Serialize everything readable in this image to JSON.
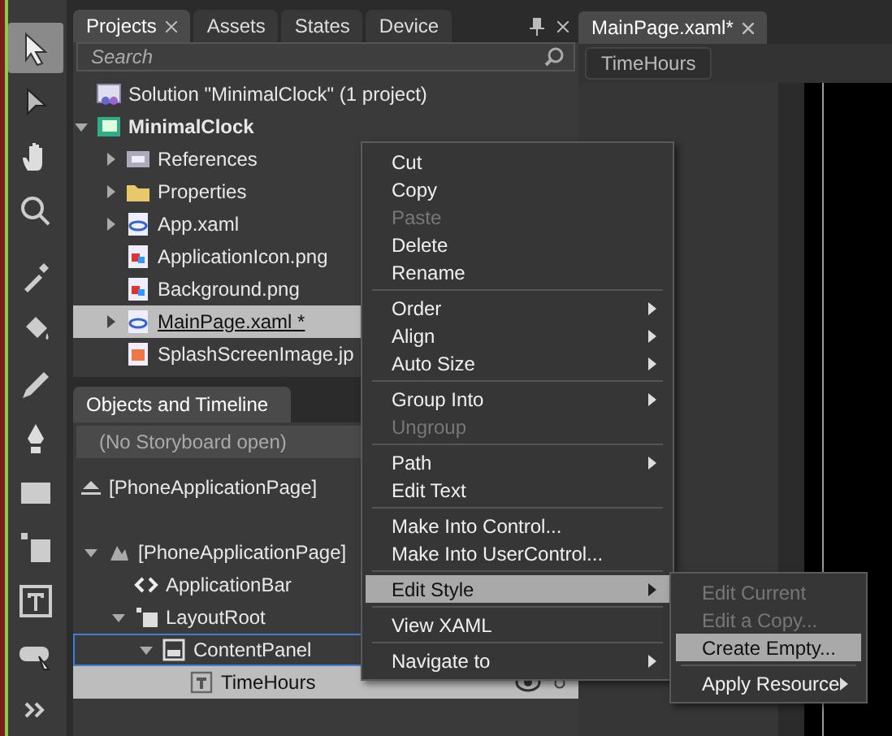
{
  "tools": [
    {
      "kind": "selection",
      "selected": true
    },
    {
      "kind": "direct-selection",
      "selected": false
    },
    {
      "kind": "pan",
      "selected": false
    },
    {
      "kind": "zoom",
      "selected": false
    },
    {
      "kind": "eyedropper",
      "selected": false
    },
    {
      "kind": "paint-bucket",
      "selected": false
    },
    {
      "kind": "pencil",
      "selected": false
    },
    {
      "kind": "pen",
      "selected": false
    },
    {
      "kind": "rectangle",
      "selected": false
    },
    {
      "kind": "grid",
      "selected": false
    },
    {
      "kind": "text",
      "selected": false
    },
    {
      "kind": "callout",
      "selected": false
    },
    {
      "kind": "more",
      "selected": false
    }
  ],
  "panel_tabs": [
    {
      "label": "Projects",
      "selected": true,
      "closable": true
    },
    {
      "label": "Assets",
      "selected": false,
      "closable": false
    },
    {
      "label": "States",
      "selected": false,
      "closable": false
    },
    {
      "label": "Device",
      "selected": false,
      "closable": false
    }
  ],
  "search": {
    "placeholder": "Search"
  },
  "project_tree": [
    {
      "label": "Solution \"MinimalClock\" (1 project)",
      "kind": "solution",
      "bold": false,
      "selected": false
    },
    {
      "label": "MinimalClock",
      "kind": "project",
      "bold": true,
      "expanded": true,
      "selected": false,
      "children": [
        {
          "label": "References",
          "kind": "references",
          "bold": false,
          "expanded": false,
          "selected": false
        },
        {
          "label": "Properties",
          "kind": "folder",
          "bold": false,
          "expanded": false,
          "selected": false
        },
        {
          "label": "App.xaml",
          "kind": "xaml",
          "bold": false,
          "expanded": false,
          "selected": false
        },
        {
          "label": "ApplicationIcon.png",
          "kind": "image",
          "bold": false,
          "selected": false
        },
        {
          "label": "Background.png",
          "kind": "image",
          "bold": false,
          "selected": false
        },
        {
          "label": "MainPage.xaml *",
          "kind": "xaml",
          "bold": false,
          "expanded": false,
          "selected": true
        },
        {
          "label": "SplashScreenImage.jp",
          "kind": "photo",
          "bold": false,
          "selected": false
        }
      ]
    }
  ],
  "objects_panel": {
    "title": "Objects and Timeline",
    "storyboard": "(No Storyboard open)",
    "scope": "[PhoneApplicationPage]",
    "tree": [
      {
        "label": "[PhoneApplicationPage]",
        "kind": "page",
        "expanded": true,
        "selected": false,
        "focused": false,
        "children": [
          {
            "label": "ApplicationBar",
            "kind": "code",
            "selected": false,
            "focused": false
          },
          {
            "label": "LayoutRoot",
            "kind": "grid",
            "expanded": true,
            "selected": false,
            "focused": false,
            "children": [
              {
                "label": "ContentPanel",
                "kind": "panel",
                "expanded": true,
                "selected": false,
                "focused": true,
                "children": [
                  {
                    "label": "TimeHours",
                    "kind": "textblock",
                    "selected": true,
                    "focused": false
                  }
                ]
              }
            ]
          }
        ]
      }
    ]
  },
  "document": {
    "tab": "MainPage.xaml*",
    "breadcrumb": "TimeHours"
  },
  "context_menu": [
    {
      "kind": "item",
      "label": "Cut",
      "disabled": false,
      "submenu": false,
      "selected": false
    },
    {
      "kind": "item",
      "label": "Copy",
      "disabled": false,
      "submenu": false,
      "selected": false
    },
    {
      "kind": "item",
      "label": "Paste",
      "disabled": true,
      "submenu": false,
      "selected": false
    },
    {
      "kind": "item",
      "label": "Delete",
      "disabled": false,
      "submenu": false,
      "selected": false
    },
    {
      "kind": "item",
      "label": "Rename",
      "disabled": false,
      "submenu": false,
      "selected": false
    },
    {
      "kind": "separator"
    },
    {
      "kind": "item",
      "label": "Order",
      "disabled": false,
      "submenu": true,
      "selected": false
    },
    {
      "kind": "item",
      "label": "Align",
      "disabled": false,
      "submenu": true,
      "selected": false
    },
    {
      "kind": "item",
      "label": "Auto Size",
      "disabled": false,
      "submenu": true,
      "selected": false
    },
    {
      "kind": "separator"
    },
    {
      "kind": "item",
      "label": "Group Into",
      "disabled": false,
      "submenu": true,
      "selected": false
    },
    {
      "kind": "item",
      "label": "Ungroup",
      "disabled": true,
      "submenu": false,
      "selected": false
    },
    {
      "kind": "separator"
    },
    {
      "kind": "item",
      "label": "Path",
      "disabled": false,
      "submenu": true,
      "selected": false
    },
    {
      "kind": "item",
      "label": "Edit Text",
      "disabled": false,
      "submenu": false,
      "selected": false
    },
    {
      "kind": "separator"
    },
    {
      "kind": "item",
      "label": "Make Into Control...",
      "disabled": false,
      "submenu": false,
      "selected": false
    },
    {
      "kind": "item",
      "label": "Make Into UserControl...",
      "disabled": false,
      "submenu": false,
      "selected": false
    },
    {
      "kind": "separator"
    },
    {
      "kind": "item",
      "label": "Edit Style",
      "disabled": false,
      "submenu": true,
      "selected": true
    },
    {
      "kind": "separator"
    },
    {
      "kind": "item",
      "label": "View XAML",
      "disabled": false,
      "submenu": false,
      "selected": false
    },
    {
      "kind": "separator"
    },
    {
      "kind": "item",
      "label": "Navigate to",
      "disabled": false,
      "submenu": true,
      "selected": false
    }
  ],
  "submenu": [
    {
      "kind": "item",
      "label": "Edit Current",
      "disabled": true,
      "submenu": false,
      "selected": false
    },
    {
      "kind": "item",
      "label": "Edit a Copy...",
      "disabled": true,
      "submenu": false,
      "selected": false
    },
    {
      "kind": "item",
      "label": "Create Empty...",
      "disabled": false,
      "submenu": false,
      "selected": true
    },
    {
      "kind": "separator"
    },
    {
      "kind": "item",
      "label": "Apply Resource",
      "disabled": false,
      "submenu": true,
      "selected": false
    }
  ]
}
